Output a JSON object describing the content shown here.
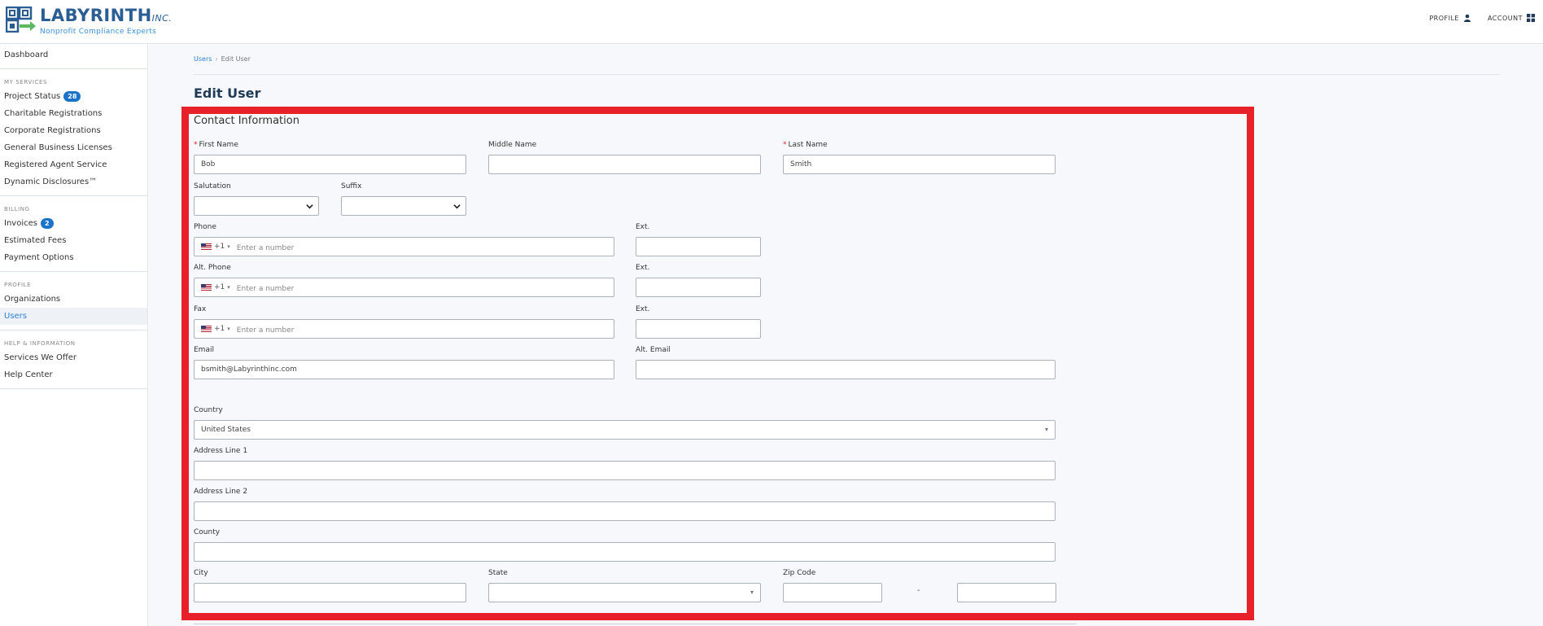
{
  "header": {
    "logo_name": "LABYRINTH",
    "logo_inc": "INC.",
    "logo_tagline": "Nonprofit Compliance Experts",
    "profile_label": "PROFILE",
    "account_label": "ACCOUNT"
  },
  "sidebar": {
    "dashboard": "Dashboard",
    "my_services_heading": "MY SERVICES",
    "project_status": "Project Status",
    "project_status_count": "28",
    "charitable_registrations": "Charitable Registrations",
    "corporate_registrations": "Corporate Registrations",
    "general_business_licenses": "General Business Licenses",
    "registered_agent_service": "Registered Agent Service",
    "dynamic_disclosures": "Dynamic Disclosures™",
    "billing_heading": "BILLING",
    "invoices": "Invoices",
    "invoices_count": "2",
    "estimated_fees": "Estimated Fees",
    "payment_options": "Payment Options",
    "profile_heading": "PROFILE",
    "organizations": "Organizations",
    "users": "Users",
    "help_heading": "HELP & INFORMATION",
    "services_we_offer": "Services We Offer",
    "help_center": "Help Center"
  },
  "main": {
    "breadcrumb_users": "Users",
    "breadcrumb_current": "Edit User",
    "page_title": "Edit User",
    "section_title": "Contact Information"
  },
  "form": {
    "first_name_label": "First Name",
    "first_name_value": "Bob",
    "middle_name_label": "Middle Name",
    "middle_name_value": "",
    "last_name_label": "Last Name",
    "last_name_value": "Smith",
    "salutation_label": "Salutation",
    "suffix_label": "Suffix",
    "phone_label": "Phone",
    "alt_phone_label": "Alt. Phone",
    "fax_label": "Fax",
    "ext_label": "Ext.",
    "country_code": "+1",
    "phone_placeholder": "Enter a number",
    "email_label": "Email",
    "email_value": "bsmith@Labyrinthinc.com",
    "alt_email_label": "Alt. Email",
    "country_label": "Country",
    "country_value": "United States",
    "address1_label": "Address Line 1",
    "address2_label": "Address Line 2",
    "county_label": "County",
    "city_label": "City",
    "state_label": "State",
    "zip_label": "Zip Code",
    "zip_separator": "-"
  },
  "colors": {
    "brand": "#2a5d93",
    "accent": "#1a73c9",
    "highlight": "#e8202a"
  }
}
